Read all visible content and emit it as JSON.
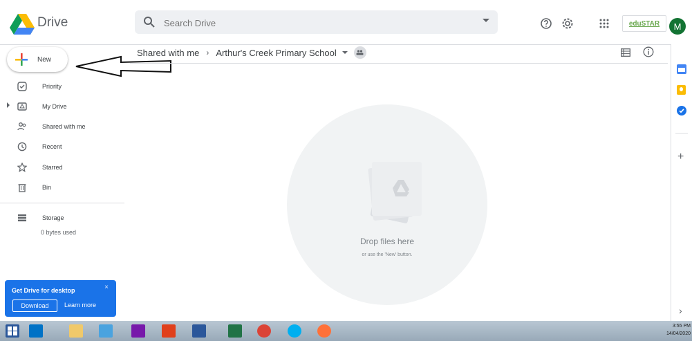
{
  "app": {
    "name": "Drive",
    "search_placeholder": "Search Drive",
    "brand_badge": "eduSTAR",
    "avatar_letter": "M"
  },
  "new_button": {
    "label": "New"
  },
  "sidebar": {
    "items": [
      {
        "label": "Priority",
        "icon": "priority-icon"
      },
      {
        "label": "My Drive",
        "icon": "my-drive-icon"
      },
      {
        "label": "Shared with me",
        "icon": "shared-with-me-icon"
      },
      {
        "label": "Recent",
        "icon": "recent-icon"
      },
      {
        "label": "Starred",
        "icon": "star-icon"
      },
      {
        "label": "Bin",
        "icon": "bin-icon"
      }
    ],
    "storage": {
      "label": "Storage",
      "usage": "0 bytes used"
    }
  },
  "breadcrumb": {
    "parent": "Shared with me",
    "current": "Arthur's Creek Primary School"
  },
  "empty_state": {
    "title": "Drop files here",
    "subtitle": "or use the 'New' button."
  },
  "promo": {
    "title": "Get Drive for desktop",
    "download": "Download",
    "learn_more": "Learn more",
    "close": "×"
  },
  "taskbar": {
    "time": "3:55 PM",
    "date": "14/04/2020"
  },
  "colors": {
    "accent": "#1a73e8",
    "avatar": "#137333"
  }
}
